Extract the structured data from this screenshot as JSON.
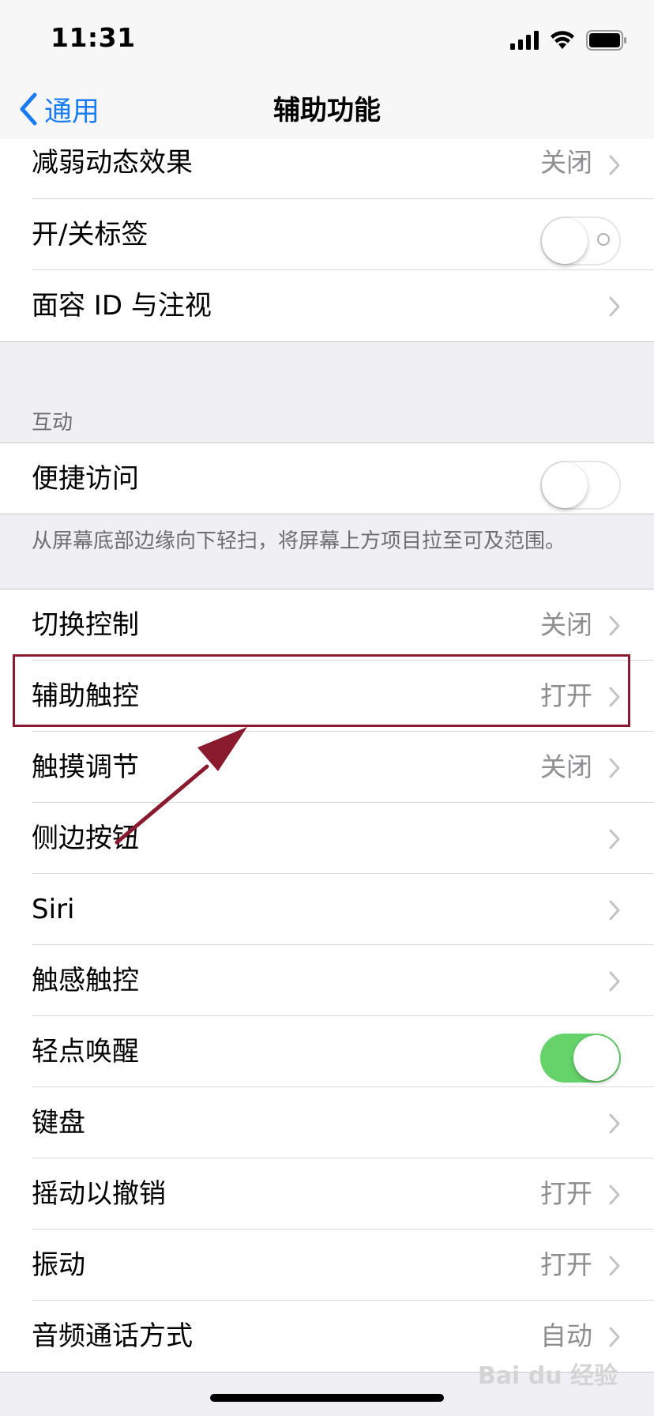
{
  "status_bar": {
    "time": "11:31",
    "icons": [
      "cellular-signal-icon",
      "wifi-icon",
      "battery-icon"
    ]
  },
  "nav": {
    "back_label": "通用",
    "title": "辅助功能"
  },
  "group_top": [
    {
      "label": "减弱动态效果",
      "value": "关闭"
    },
    {
      "label": "开/关标签",
      "switch": "off"
    },
    {
      "label": "面容 ID 与注视"
    }
  ],
  "interaction_header": "互动",
  "reachability": {
    "label": "便捷访问",
    "switch": "off"
  },
  "reachability_footer": "从屏幕底部边缘向下轻扫，将屏幕上方项目拉至可及范围。",
  "group_bottom": [
    {
      "label": "切换控制",
      "value": "关闭"
    },
    {
      "label": "辅助触控",
      "value": "打开"
    },
    {
      "label": "触摸调节",
      "value": "关闭"
    },
    {
      "label": "侧边按钮"
    },
    {
      "label": "Siri"
    },
    {
      "label": "触感触控"
    },
    {
      "label": "轻点唤醒",
      "switch": "on"
    },
    {
      "label": "键盘"
    },
    {
      "label": "摇动以撤销",
      "value": "打开"
    },
    {
      "label": "振动",
      "value": "打开"
    },
    {
      "label": "音频通话方式",
      "value": "自动"
    }
  ],
  "watermark": "Bai du 经验",
  "colors": {
    "accent": "#1a7cf5",
    "switch_on": "#65d36a",
    "annotation": "#8a1a2e"
  }
}
